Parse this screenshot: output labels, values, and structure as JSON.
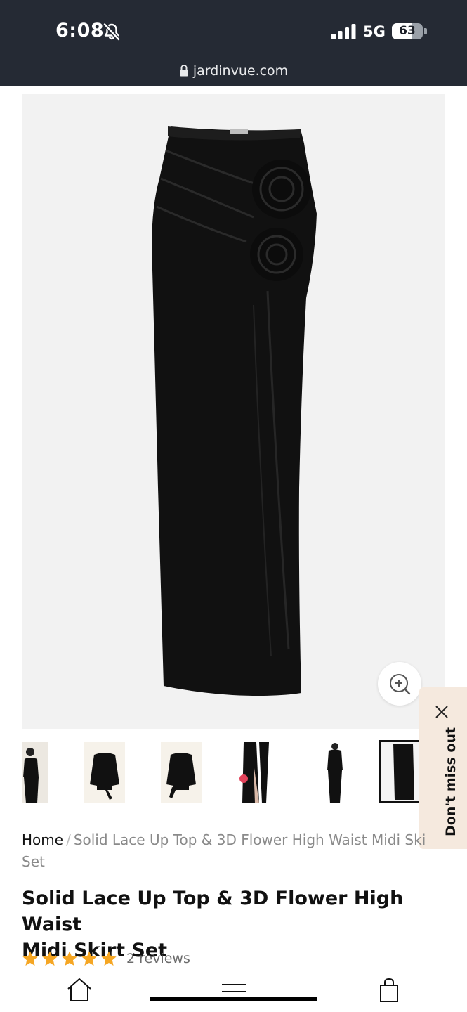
{
  "status_bar": {
    "time": "6:08",
    "network": "5G",
    "battery_level": "63",
    "battery_fraction": 0.63,
    "url": "jardinvue.com",
    "icons": [
      "bell-slash-icon",
      "signal-icon",
      "battery-icon",
      "lock-icon"
    ]
  },
  "gallery": {
    "main_image": "black-ruched-midi-skirt-with-3d-rosettes",
    "zoom_icon": "zoom-in-icon",
    "thumbnails": [
      "model-black-top-and-skirt",
      "black-wrap-top",
      "black-wrap-top-side",
      "model-skirt-with-slit",
      "model-full-outfit",
      "skirt-detail"
    ],
    "active_thumbnail": 5
  },
  "promo": {
    "label": "Don't miss out",
    "close_icon": "close-icon"
  },
  "breadcrumb": {
    "home": "Home",
    "separator": "/",
    "current_line1": "Solid Lace Up Top & 3D Flower High Waist Midi Ski",
    "current_line2": "Set"
  },
  "product": {
    "title_line1": "Solid Lace Up Top & 3D Flower High Waist",
    "title_line2": "Midi Skirt Set",
    "rating": 5,
    "reviews": "2 reviews"
  },
  "bottom_nav": {
    "items": [
      "home-icon",
      "menu-icon",
      "bag-icon"
    ]
  },
  "colors": {
    "status_bar_bg": "#252a34",
    "star": "#f5a623",
    "promo_bg": "#f5e9de"
  }
}
